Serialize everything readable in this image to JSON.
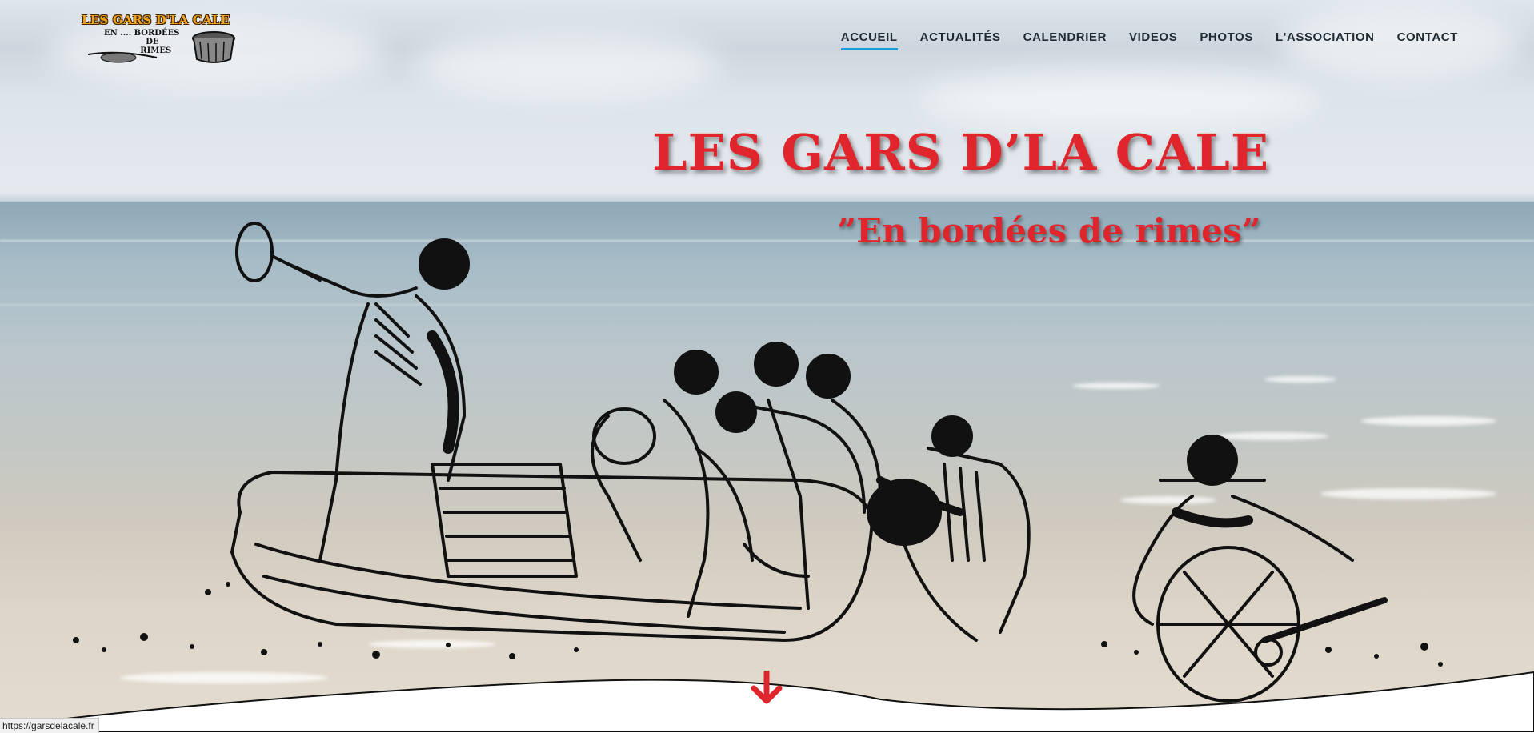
{
  "site": {
    "logo_line1": "LES GARS D'LA CALE",
    "logo_line2": "EN .... BORDÉES\n               DE\n             RIMES"
  },
  "nav": {
    "items": [
      {
        "label": "ACCUEIL",
        "active": true
      },
      {
        "label": "ACTUALITÉS",
        "active": false
      },
      {
        "label": "CALENDRIER",
        "active": false
      },
      {
        "label": "VIDEOS",
        "active": false
      },
      {
        "label": "PHOTOS",
        "active": false
      },
      {
        "label": "L'ASSOCIATION",
        "active": false
      },
      {
        "label": "CONTACT",
        "active": false
      }
    ]
  },
  "hero": {
    "title": "LES GARS D’LA CALE",
    "subtitle": "”En bordées de rimes”",
    "scroll_icon": "arrow-down-icon"
  },
  "status_bar": {
    "url": "https://garsdelacale.fr"
  },
  "colors": {
    "title_red": "#e0262c",
    "nav_active_underline": "#1a9ed9",
    "nav_text": "#1d2a33",
    "logo_orange": "#f0a21c"
  }
}
